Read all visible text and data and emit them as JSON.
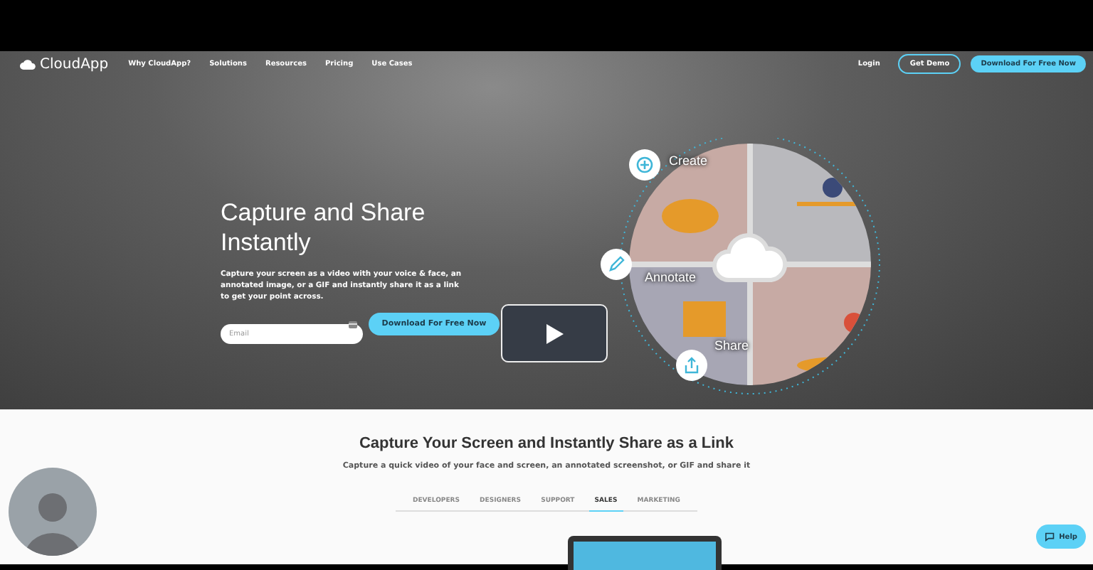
{
  "nav": {
    "logo": "CloudApp",
    "links": [
      "Why CloudApp?",
      "Solutions",
      "Resources",
      "Pricing",
      "Use Cases"
    ],
    "login": "Login",
    "demo_button": "Get Demo",
    "download_button": "Download For Free Now"
  },
  "hero": {
    "title": "Capture and Share Instantly",
    "text": "Capture your screen as a video with your voice & face, an annotated image, or a GIF and instantly share it as a link to get your point across.",
    "email": {
      "placeholder": "Email"
    },
    "download_button": "Download For Free Now",
    "illustration_labels": [
      "Create",
      "Annotate",
      "Share"
    ]
  },
  "section": {
    "title": "Capture Your Screen and Instantly Share as a Link",
    "subtitle": "Capture a quick video of your face and screen, an annotated screenshot, or GIF and share it",
    "tabs": [
      {
        "label": "DEVELOPERS",
        "selected": false
      },
      {
        "label": "DESIGNERS",
        "selected": false
      },
      {
        "label": "SUPPORT",
        "selected": false
      },
      {
        "label": "SALES",
        "selected": true
      },
      {
        "label": "MARKETING",
        "selected": false
      }
    ]
  },
  "help_button": "Help"
}
